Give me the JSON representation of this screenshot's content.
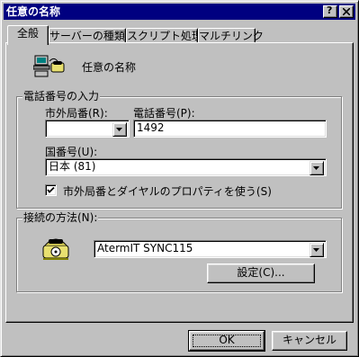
{
  "window": {
    "title": "任意の名称"
  },
  "titlebar_buttons": {
    "help": "?",
    "close": "×"
  },
  "tabs": [
    {
      "label": "全般",
      "active": true
    },
    {
      "label": "サーバーの種類",
      "active": false
    },
    {
      "label": "スクリプト処理",
      "active": false
    },
    {
      "label": "マルチリンク",
      "active": false
    }
  ],
  "connection": {
    "name": "任意の名称",
    "icon": "dialup-network-icon"
  },
  "phone_group": {
    "label": "電話番号の入力",
    "area_code_label": "市外局番(R):",
    "area_code_value": "",
    "separator": "-",
    "number_label": "電話番号(P):",
    "number_value": "1492",
    "country_label": "国番号(U):",
    "country_value": "日本 (81)",
    "use_area_code_label": "市外局番とダイヤルのプロパティを使う(S)",
    "use_area_code_checked": true
  },
  "connect_group": {
    "label": "接続の方法(N):",
    "icon": "modem-telephone-icon",
    "modem_value": "AtermIT SYNC115",
    "configure_label": "設定(C)..."
  },
  "buttons": {
    "ok": "OK",
    "cancel": "キャンセル"
  }
}
